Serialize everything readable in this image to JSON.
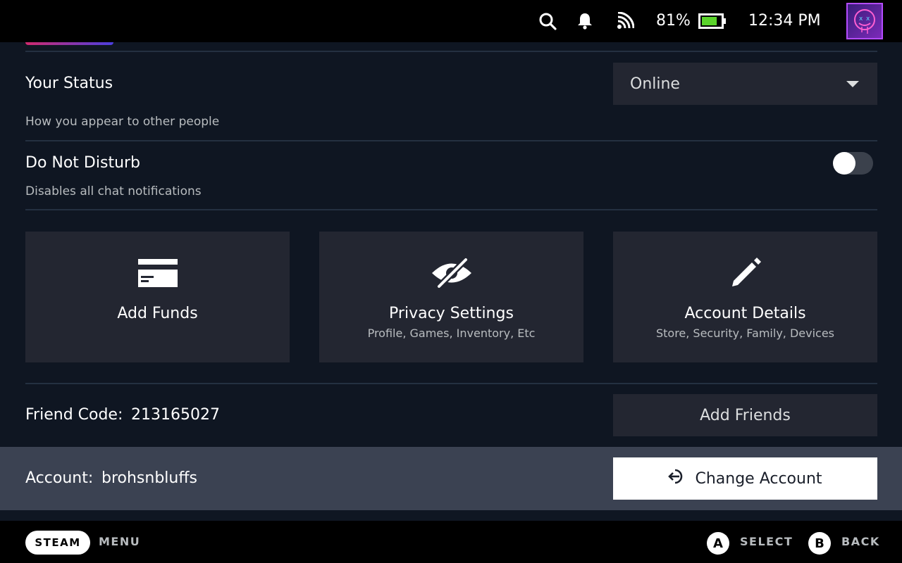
{
  "status_bar": {
    "battery_percent_label": "81%",
    "battery_level": 0.81,
    "time": "12:34 PM",
    "icons": [
      "search-icon",
      "bell-icon",
      "wifi-icon",
      "battery-icon",
      "avatar"
    ]
  },
  "status": {
    "label": "Your Status",
    "description": "How you appear to other people",
    "selected": "Online"
  },
  "dnd": {
    "label": "Do Not Disturb",
    "description": "Disables all chat notifications",
    "enabled": false
  },
  "tiles": [
    {
      "icon": "credit-card-icon",
      "title": "Add Funds",
      "subtitle": ""
    },
    {
      "icon": "eye-slash-icon",
      "title": "Privacy Settings",
      "subtitle": "Profile, Games, Inventory, Etc"
    },
    {
      "icon": "pencil-icon",
      "title": "Account Details",
      "subtitle": "Store, Security, Family, Devices"
    }
  ],
  "friend_code": {
    "label": "Friend Code:",
    "value": "213165027",
    "button": "Add Friends"
  },
  "account": {
    "label": "Account:",
    "name": "brohsnbluffs",
    "button": "Change Account",
    "button_icon": "sign-in-icon"
  },
  "footer": {
    "steam": "STEAM",
    "menu": "MENU",
    "a_key": "A",
    "select": "SELECT",
    "b_key": "B",
    "back": "BACK"
  },
  "colors": {
    "background": "#0f1622",
    "panel": "#232631",
    "highlight_row": "#3b4252",
    "battery_fill": "#5bd42b",
    "avatar_border": "#b44cff"
  }
}
